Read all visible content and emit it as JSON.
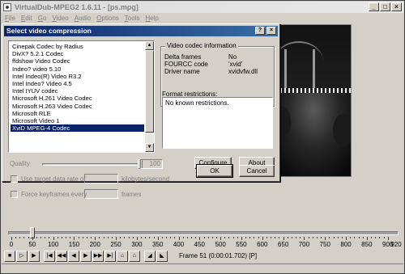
{
  "app": {
    "title": "VirtualDub-MPEG2 1.6.11 - [ps.mpg]",
    "window_buttons": [
      "_",
      "□",
      "×"
    ],
    "menu": [
      "File",
      "Edit",
      "Go",
      "Video",
      "Audio",
      "Options",
      "Tools",
      "Help"
    ]
  },
  "dialog": {
    "title": "Select video compression",
    "title_buttons": [
      "?",
      "×"
    ],
    "codecs": [
      "Cinepak Codec by Radius",
      "DivX? 5.2.1 Codec",
      "ffdshow Video Codec",
      "Indeo? video 5.10",
      "Intel Indeo(R) Video R3.2",
      "Intel Indeo? Video 4.5",
      "Intel IYUV codec",
      "Microsoft H.261 Video Codec",
      "Microsoft H.263 Video Codec",
      "Microsoft RLE",
      "Microsoft Video 1",
      "XviD MPEG-4 Codec"
    ],
    "selected_codec_index": 11,
    "info": {
      "legend": "Video codec information",
      "rows": [
        {
          "label": "Delta frames",
          "value": "No"
        },
        {
          "label": "FOURCC code",
          "value": "'xvid'"
        },
        {
          "label": "Driver name",
          "value": "xvidvfw.dll"
        }
      ]
    },
    "restrictions_label": "Format restrictions:",
    "restrictions_text": "No known restrictions.",
    "quality_label": "Quality",
    "quality_value": "100",
    "use_data_rate_label": "Use target data rate of",
    "data_rate_unit": "kilobytes/second",
    "force_keyframes_label": "Force keyframes every",
    "keyframes_unit": "frames",
    "configure_label": "Configure",
    "about_label": "About",
    "ok_label": "OK",
    "cancel_label": "Cancel"
  },
  "timeline": {
    "tick_labels": [
      "0",
      "50",
      "100",
      "150",
      "200",
      "250",
      "300",
      "350",
      "400",
      "450",
      "500",
      "550",
      "600",
      "650",
      "700",
      "750",
      "800",
      "850",
      "900",
      "920"
    ],
    "position_value": 51,
    "frame_info": "Frame 51 (0:00:01.702) [P]"
  },
  "toolbar": {
    "buttons": [
      "stop-icon",
      "play-input-icon",
      "play-output-icon",
      "start-icon",
      "prev-key-icon",
      "prev-frame-icon",
      "next-frame-icon",
      "next-key-icon",
      "end-icon",
      "scene-back-icon",
      "scene-fwd-icon",
      "mark-in-icon",
      "mark-out-icon"
    ]
  }
}
